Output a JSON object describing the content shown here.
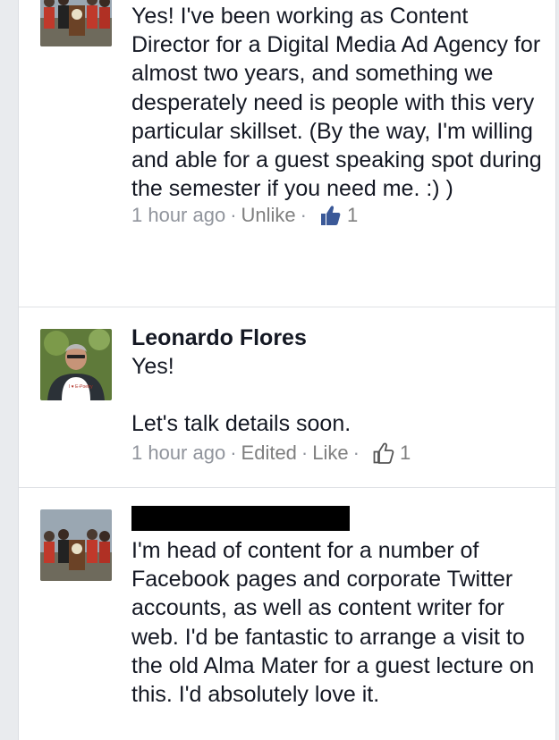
{
  "comments": [
    {
      "text": "Yes! I've been working as Content Director for a Digital Media Ad Agency for almost two years, and something we desperately need is people with this very particular skillset. (By the way, I'm willing and able for a guest speaking spot during the semester if you need me. :) )",
      "meta": {
        "time": "1 hour ago",
        "actions": [
          "Unlike"
        ],
        "like_count": "1"
      }
    },
    {
      "author": "Leonardo Flores",
      "text": "Yes!\n\nLet's talk details soon.",
      "meta": {
        "time": "1 hour ago",
        "actions": [
          "Edited",
          "Like"
        ],
        "like_count": "1"
      }
    },
    {
      "author_redacted": true,
      "text": "I'm head of content for a number of Facebook pages and corporate Twitter accounts, as well as content writer for web. I'd be fantastic to arrange a visit to the old Alma Mater for a guest lecture on this. I'd absolutely love it."
    }
  ],
  "avatar_shirt_text": "I ♥ E-Poetry",
  "colors": {
    "text": "#141823",
    "meta": "#90949c",
    "like_blue": "#3b5998",
    "separator": "#dfe1e5"
  }
}
